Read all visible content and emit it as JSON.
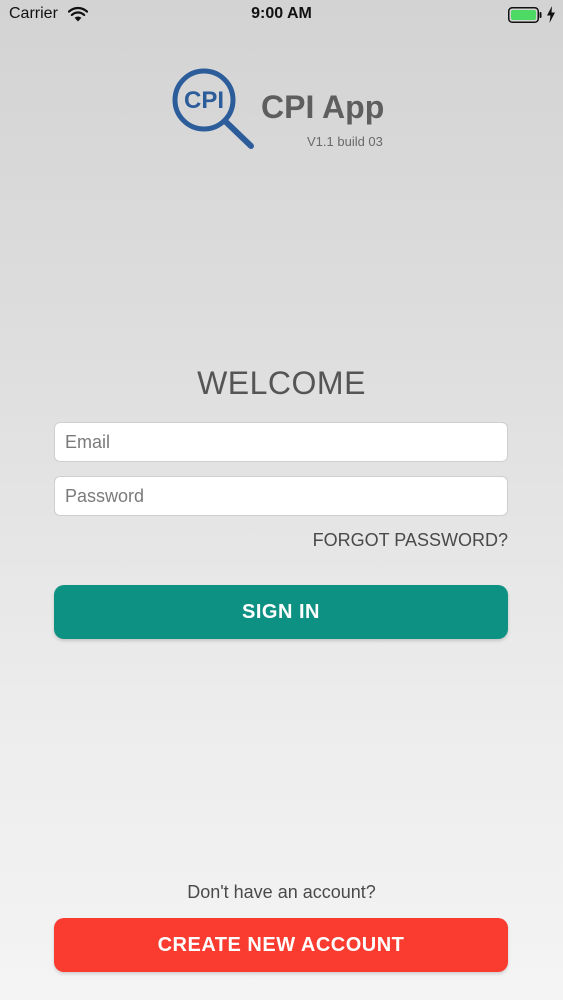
{
  "status_bar": {
    "carrier": "Carrier",
    "time": "9:00 AM",
    "wifi_icon": "wifi-icon",
    "battery_icon": "battery-full-icon",
    "charging_icon": "lightning-bolt-icon"
  },
  "app": {
    "logo_text": "CPI",
    "name": "CPI App",
    "version": "V1.1 build 03"
  },
  "login": {
    "heading": "WELCOME",
    "email_placeholder": "Email",
    "email_value": "",
    "password_placeholder": "Password",
    "password_value": "",
    "forgot_password": "FORGOT PASSWORD?",
    "sign_in": "SIGN IN"
  },
  "signup": {
    "prompt": "Don't have an account?",
    "create_account": "CREATE NEW ACCOUNT"
  },
  "colors": {
    "primary": "#0d9182",
    "danger": "#fa3b30",
    "logo_blue": "#2c5c9a",
    "battery_green": "#4cd964"
  }
}
